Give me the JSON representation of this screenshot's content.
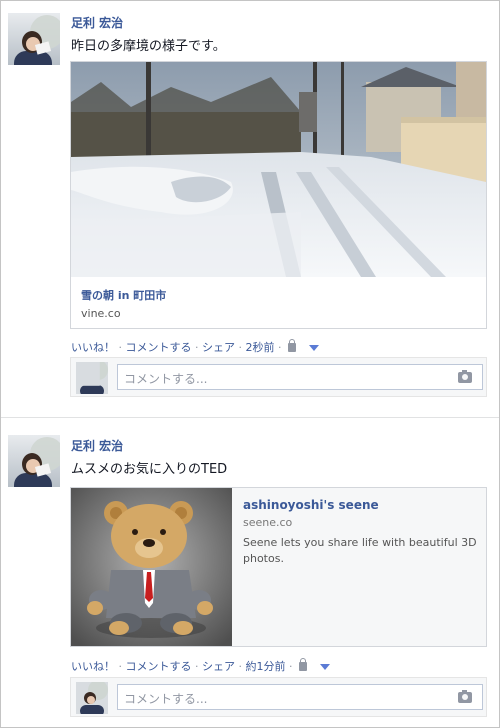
{
  "posts": [
    {
      "author": "足利 宏治",
      "text": "昨日の多摩境の様子です。",
      "attachment": {
        "title": "雪の朝 in 町田市",
        "domain": "vine.co"
      },
      "actions": {
        "like": "いいね！",
        "comment": "コメントする",
        "share": "シェア",
        "time": "2秒前",
        "privacy_icon": "lock-icon"
      },
      "comment_placeholder": "コメントする..."
    },
    {
      "author": "足利 宏治",
      "text": "ムスメのお気に入りのTED",
      "attachment": {
        "title": "ashinoyoshi's seene",
        "domain": "seene.co",
        "description": "Seene lets you share life with beautiful 3D photos."
      },
      "actions": {
        "like": "いいね！",
        "comment": "コメントする",
        "share": "シェア",
        "time": "約1分前",
        "privacy_icon": "lock-icon"
      },
      "comment_placeholder": "コメントする..."
    }
  ],
  "colors": {
    "link": "#3b5998",
    "meta": "#9197a3"
  }
}
